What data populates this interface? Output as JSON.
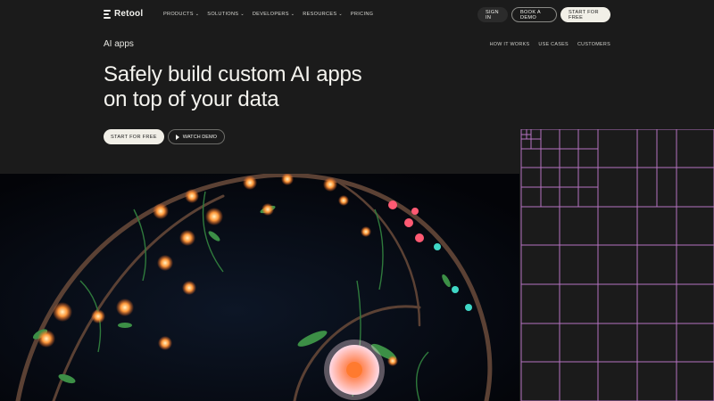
{
  "brand": {
    "name": "Retool"
  },
  "nav": {
    "items": [
      {
        "label": "PRODUCTS"
      },
      {
        "label": "SOLUTIONS"
      },
      {
        "label": "DEVELOPERS"
      },
      {
        "label": "RESOURCES"
      },
      {
        "label": "PRICING"
      }
    ],
    "sign_in": "SIGN IN",
    "book_demo": "BOOK A DEMO",
    "start_free": "START FOR FREE"
  },
  "subnav": {
    "title": "AI apps",
    "links": [
      "HOW IT WORKS",
      "USE CASES",
      "CUSTOMERS"
    ]
  },
  "hero": {
    "title_line1": "Safely build custom AI apps",
    "title_line2": "on top of your data",
    "primary_cta": "START FOR FREE",
    "secondary_cta": "WATCH DEMO"
  },
  "colors": {
    "background": "#1b1b1b",
    "text": "#f2f2ee",
    "cta_light": "#f1efe7",
    "grid_line": "#b673c2"
  }
}
